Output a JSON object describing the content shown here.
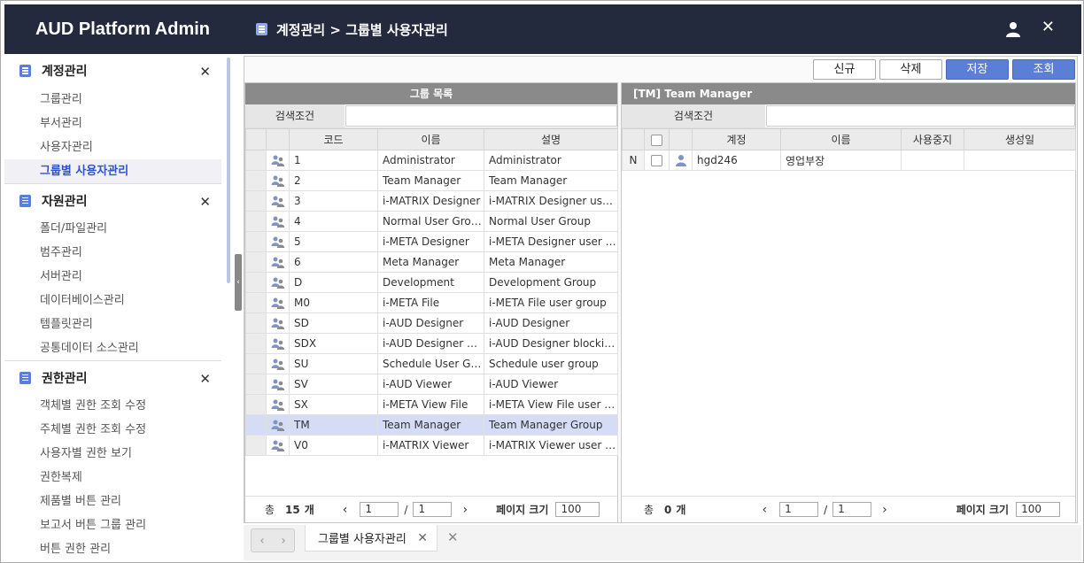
{
  "app": {
    "brand": "AUD Platform Admin",
    "breadcrumb": "계정관리 > 그룹별 사용자관리"
  },
  "sidebar": {
    "sections": [
      {
        "title": "계정관리",
        "items": [
          "그룹관리",
          "부서관리",
          "사용자관리",
          "그룹별 사용자관리"
        ],
        "active": 3
      },
      {
        "title": "자원관리",
        "items": [
          "폴더/파일관리",
          "범주관리",
          "서버관리",
          "데이터베이스관리",
          "템플릿관리",
          "공통데이터 소스관리"
        ]
      },
      {
        "title": "권한관리",
        "items": [
          "객체별 권한 조회 수정",
          "주체별 권한 조회 수정",
          "사용자별 권한 보기",
          "권한복제",
          "제품별 버튼 관리",
          "보고서 버튼 그룹 관리",
          "버튼 권한 관리"
        ]
      }
    ]
  },
  "toolbar": {
    "new": "신규",
    "delete": "삭제",
    "save": "저장",
    "search": "조회"
  },
  "left_panel": {
    "title": "그룹 목록",
    "search_label": "검색조건",
    "search_value": "",
    "columns": [
      "코드",
      "이름",
      "설명"
    ],
    "rows": [
      [
        "1",
        "Administrator",
        "Administrator"
      ],
      [
        "2",
        "Team Manager",
        "Team Manager"
      ],
      [
        "3",
        "i-MATRIX Designer",
        "i-MATRIX Designer user group"
      ],
      [
        "4",
        "Normal User Group",
        "Normal User Group"
      ],
      [
        "5",
        "i-META Designer",
        "i-META Designer user group"
      ],
      [
        "6",
        "Meta Manager",
        "Meta Manager"
      ],
      [
        "D",
        "Development",
        "Development Group"
      ],
      [
        "M0",
        "i-META File",
        "i-META File user group"
      ],
      [
        "SD",
        "i-AUD Designer",
        "i-AUD Designer"
      ],
      [
        "SDX",
        "i-AUD Designer blocking",
        "i-AUD Designer blocking group"
      ],
      [
        "SU",
        "Schedule User Group",
        "Schedule user group"
      ],
      [
        "SV",
        "i-AUD Viewer",
        "i-AUD Viewer"
      ],
      [
        "SX",
        "i-META View File",
        "i-META View File user group"
      ],
      [
        "TM",
        "Team Manager",
        "Team Manager Group"
      ],
      [
        "V0",
        "i-MATRIX Viewer",
        "i-MATRIX Viewer user group"
      ]
    ],
    "selected_index": 13,
    "footer": {
      "total_label": "총",
      "total": "15",
      "unit": "개",
      "page": "1",
      "sep": "/",
      "pages": "1",
      "size_label": "페이지 크기",
      "size": "100"
    }
  },
  "right_panel": {
    "title": "[TM] Team Manager",
    "search_label": "검색조건",
    "search_value": "",
    "columns": [
      "계정",
      "이름",
      "사용중지",
      "생성일"
    ],
    "rows": [
      {
        "state": "N",
        "account": "hgd246",
        "name": "영업부장",
        "disabled": "",
        "created": ""
      }
    ],
    "footer": {
      "total_label": "총",
      "total": "0",
      "unit": "개",
      "page": "1",
      "sep": "/",
      "pages": "1",
      "size_label": "페이지 크기",
      "size": "100"
    }
  },
  "tabs": [
    {
      "label": "그룹별 사용자관리"
    }
  ],
  "colors": {
    "navy": "#232a3d",
    "accent": "#5b7fd6",
    "selected_row": "#d4dcf6",
    "panel_header": "#8a8a8a"
  }
}
